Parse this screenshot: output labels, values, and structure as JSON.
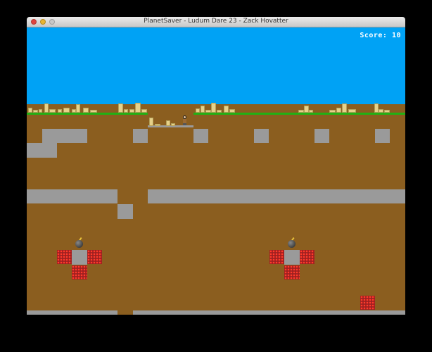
{
  "window": {
    "title": "PlanetSaver - Ludum Dare 23 - Zack Hovatter"
  },
  "hud": {
    "score_label": "Score: 10"
  },
  "colors": {
    "sky": "#00a2f5",
    "grass": "#22b014",
    "dirt": "#8b5e1f",
    "stone": "#9a9a9a",
    "tnt": "#d42a1e",
    "building": "#e7d189"
  }
}
